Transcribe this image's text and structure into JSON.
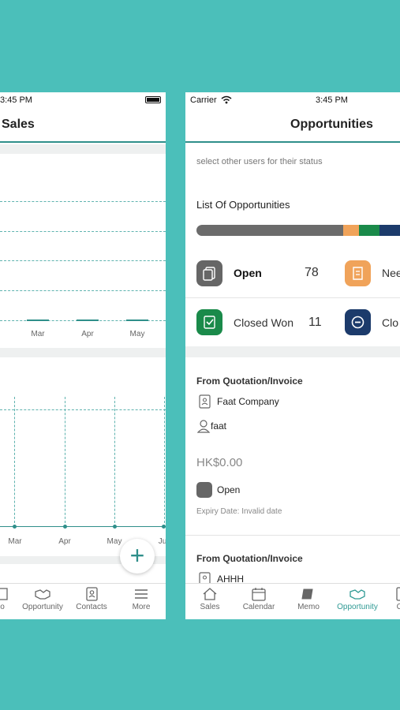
{
  "left_screen": {
    "status_time": "3:45 PM",
    "nav_title": "Sales",
    "chart_top": {
      "categories": [
        "Mar",
        "Apr",
        "May"
      ]
    },
    "chart_bottom": {
      "categories": [
        "Mar",
        "Apr",
        "May",
        "Ju"
      ]
    },
    "fab_label": "+",
    "tabs": [
      {
        "label": "o",
        "icon": "memo-icon"
      },
      {
        "label": "Opportunity",
        "icon": "handshake-icon"
      },
      {
        "label": "Contacts",
        "icon": "contacts-icon"
      },
      {
        "label": "More",
        "icon": "menu-icon"
      }
    ]
  },
  "right_screen": {
    "carrier": "Carrier",
    "status_time": "3:45 PM",
    "nav_title": "Opportunities",
    "hint": "select other users for their status",
    "list_heading": "List Of Opportunities",
    "progress_colors": [
      "#6b6b6b",
      "#f0a35a",
      "#1a8a4a",
      "#1c3b6b"
    ],
    "statuses": [
      {
        "label": "Open",
        "count": "78",
        "color": "#666666"
      },
      {
        "label": "Nee",
        "count": "",
        "color": "#f0a35a"
      },
      {
        "label": "Closed Won",
        "count": "11",
        "color": "#1a8a4a"
      },
      {
        "label": "Clo",
        "count": "",
        "color": "#1c3b6b"
      }
    ],
    "cards": [
      {
        "source": "From Quotation/Invoice",
        "company": "Faat Company",
        "contact": "faat",
        "amount": "HK$0.00",
        "status": "Open",
        "expiry": "Expiry Date: Invalid date"
      },
      {
        "source": "From Quotation/Invoice",
        "company": "AHHH"
      }
    ],
    "tabs": [
      {
        "label": "Sales",
        "icon": "home-icon"
      },
      {
        "label": "Calendar",
        "icon": "calendar-icon"
      },
      {
        "label": "Memo",
        "icon": "book-icon"
      },
      {
        "label": "Opportunity",
        "icon": "handshake-icon"
      },
      {
        "label": "Co",
        "icon": "contacts-icon"
      }
    ]
  }
}
